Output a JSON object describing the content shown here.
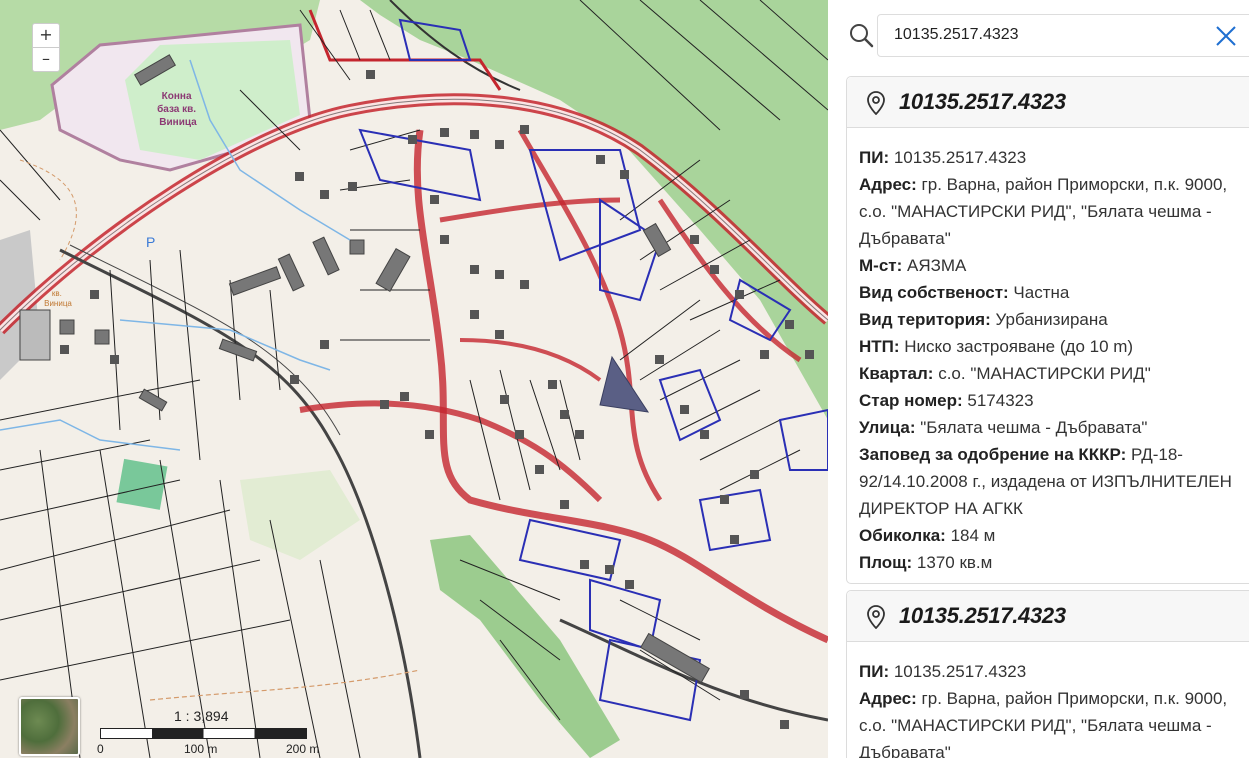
{
  "map": {
    "zoom_in": "+",
    "zoom_out": "–",
    "scale_text": "1 : 3,894",
    "scale_ticks": [
      "0",
      "100 m",
      "200 m"
    ],
    "labels": {
      "stable": "Конна\nбаза кв.\nВиница",
      "parking": "P",
      "vinitsa": "кв.\nВиница"
    }
  },
  "search": {
    "value": "10135.2517.4323",
    "icon": "search-icon",
    "clear_icon": "close-icon"
  },
  "cards": [
    {
      "title": "10135.2517.4323",
      "rows": [
        {
          "label": "ПИ:",
          "value": "10135.2517.4323"
        },
        {
          "label": "Адрес:",
          "value": "гр. Варна, район Приморски, п.к. 9000, с.о. \"МАНАСТИРСКИ РИД\", \"Бялата чешма - Дъбравата\""
        },
        {
          "label": "М-ст:",
          "value": "АЯЗМА"
        },
        {
          "label": "Вид собственост:",
          "value": "Частна"
        },
        {
          "label": "Вид територия:",
          "value": "Урбанизирана"
        },
        {
          "label": "НТП:",
          "value": "Ниско застрояване (до 10 m)"
        },
        {
          "label": "Квартал:",
          "value": "с.о. \"МАНАСТИРСКИ РИД\""
        },
        {
          "label": "Стар номер:",
          "value": "5174323"
        },
        {
          "label": "Улица:",
          "value": "\"Бялата чешма - Дъбравата\""
        },
        {
          "label": "Заповед за одобрение на КККР:",
          "value": "РД-18-92/14.10.2008 г., издадена от ИЗПЪЛНИТЕЛЕН ДИРЕКТОР НА АГКК"
        },
        {
          "label": "Обиколка:",
          "value": "184 м"
        },
        {
          "label": "Площ:",
          "value": "1370 кв.м"
        }
      ]
    },
    {
      "title": "10135.2517.4323",
      "rows": [
        {
          "label": "ПИ:",
          "value": "10135.2517.4323"
        },
        {
          "label": "Адрес:",
          "value": "гр. Варна, район Приморски, п.к. 9000, с.о. \"МАНАСТИРСКИ РИД\", \"Бялата чешма - Дъбравата\""
        }
      ]
    }
  ],
  "colors": {
    "parcel_red": "#c4262e",
    "parcel_blue": "#2a2fb5",
    "forest": "#a8d49a",
    "highlight": "#5a5f85"
  }
}
